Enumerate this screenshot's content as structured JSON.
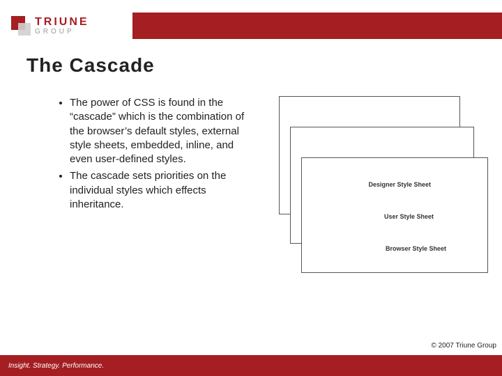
{
  "logo": {
    "brand": "TRIUNE",
    "sub": "GROUP"
  },
  "title": "The Cascade",
  "bullets": [
    "The power of CSS is found in the “cascade” which is the combination of the browser’s default styles, external style sheets, embedded, inline, and even user-defined styles.",
    "The cascade sets priorities on the individual styles which effects inheritance."
  ],
  "diagram": {
    "sheet1": "Designer Style Sheet",
    "sheet2": "User Style Sheet",
    "sheet3": "Browser Style Sheet"
  },
  "copyright": "© 2007 Triune Group",
  "footer": "Insight. Strategy. Performance."
}
